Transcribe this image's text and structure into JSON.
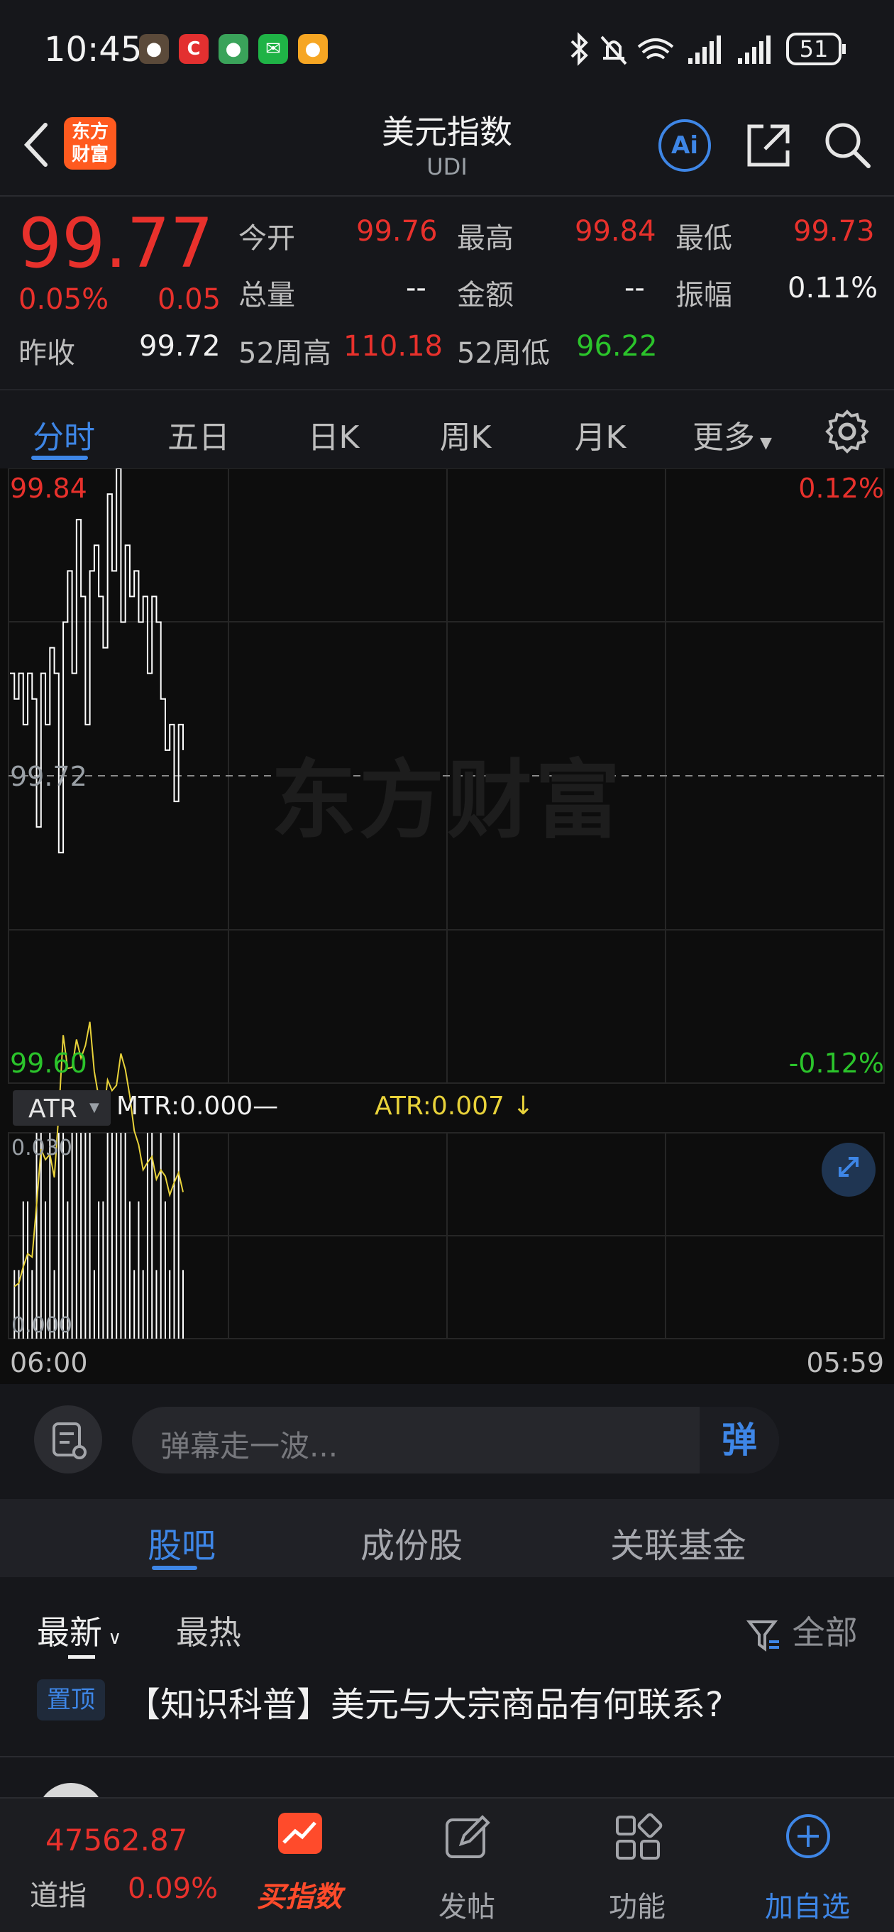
{
  "status_bar": {
    "time": "10:45",
    "battery": "51"
  },
  "header": {
    "back_label": "返回",
    "logo_text_line1": "东方",
    "logo_text_line2": "财富",
    "title": "美元指数",
    "subtitle": "UDI",
    "ai_label": "Ai"
  },
  "quote": {
    "price": "99.77",
    "change_pct": "0.05%",
    "change": "0.05",
    "open_label": "今开",
    "open": "99.76",
    "high_label": "最高",
    "high": "99.84",
    "low_label": "最低",
    "low": "99.73",
    "volume_label": "总量",
    "volume": "--",
    "amount_label": "金额",
    "amount": "--",
    "amplitude_label": "振幅",
    "amplitude": "0.11%",
    "prev_close_label": "昨收",
    "prev_close": "99.72",
    "w52_high_label": "52周高",
    "w52_high": "110.18",
    "w52_low_label": "52周低",
    "w52_low": "96.22"
  },
  "period_tabs": [
    "分时",
    "五日",
    "日K",
    "周K",
    "月K",
    "更多"
  ],
  "chart": {
    "y_top": "99.84",
    "y_mid": "99.72",
    "y_bottom": "99.60",
    "pct_top": "0.12%",
    "pct_bottom": "-0.12%",
    "watermark": "东方财富",
    "indicator_select": "ATR",
    "mtr_label": "MTR:0.000—",
    "atr_label": "ATR:0.007",
    "sub_y_top": "0.030",
    "sub_y_bottom": "0.000",
    "x_start": "06:00",
    "x_end": "05:59",
    "colors": {
      "price_line": "#ffffff",
      "atr_line": "#e8d23a",
      "up": "#e8312c",
      "down": "#2bc42b"
    }
  },
  "chart_data": {
    "type": "line",
    "title": "",
    "xlabel": "",
    "ylabel": "",
    "ylim": [
      99.6,
      99.84
    ],
    "prev_close": 99.72,
    "x_range": [
      "06:00",
      "05:59"
    ],
    "series": [
      {
        "values": [
          99.76,
          99.75,
          99.76,
          99.74,
          99.76,
          99.75,
          99.7,
          99.76,
          99.74,
          99.77,
          99.76,
          99.69,
          99.78,
          99.8,
          99.76,
          99.82,
          99.79,
          99.74,
          99.8,
          99.81,
          99.79,
          99.77,
          99.83,
          99.8,
          99.84,
          99.78,
          99.81,
          99.79,
          99.8,
          99.78,
          99.79,
          99.76,
          99.79,
          99.78,
          99.75,
          99.73,
          99.74,
          99.71,
          99.74,
          99.73
        ]
      }
    ],
    "sub_chart": {
      "indicator": "ATR",
      "ylim": [
        0.0,
        0.03
      ],
      "atr_value": 0.007,
      "mtr_value": 0.0
    }
  },
  "comment_bar": {
    "placeholder": "弹幕走一波...",
    "send_label": "弹"
  },
  "forum_tabs": [
    "股吧",
    "成份股",
    "关联基金"
  ],
  "forum": {
    "sort_latest": "最新",
    "sort_hot": "最热",
    "filter_label": "全部",
    "pin_label": "置顶",
    "pinned_title": "【知识科普】美元与大宗商品有何联系?"
  },
  "bottom_nav": {
    "index_value": "47562.87",
    "index_name": "道指",
    "index_change": "0.09%",
    "buy_label": "买指数",
    "post_label": "发帖",
    "func_label": "功能",
    "watchlist_label": "加自选"
  }
}
